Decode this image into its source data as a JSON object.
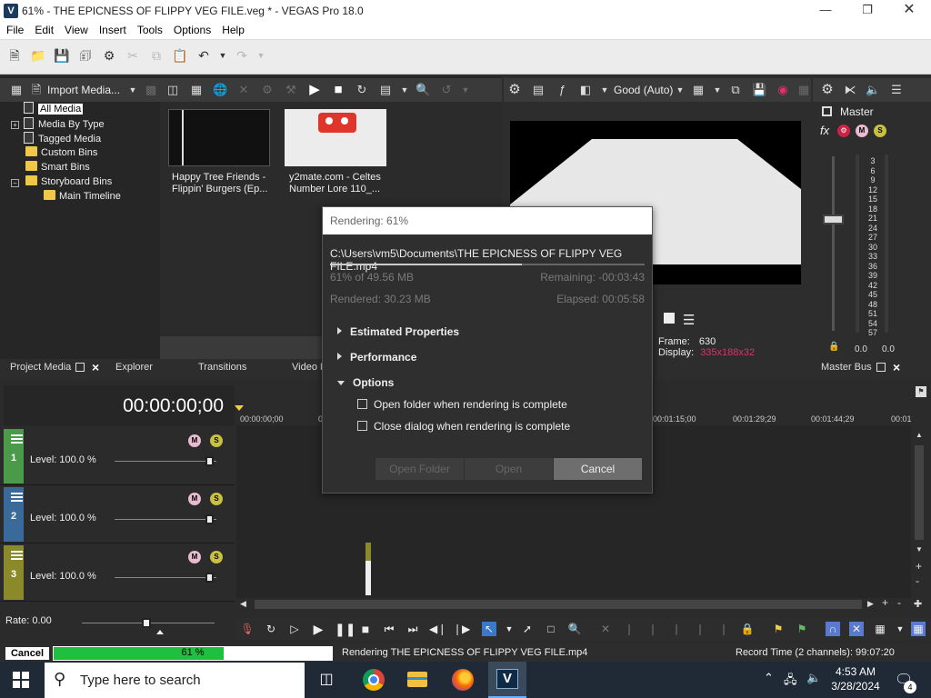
{
  "window": {
    "title": "61% - THE EPICNESS OF FLIPPY VEG FILE.veg * - VEGAS Pro 18.0",
    "app_icon": "V"
  },
  "menu": [
    "File",
    "Edit",
    "View",
    "Insert",
    "Tools",
    "Options",
    "Help"
  ],
  "media_panel": {
    "import_label": "Import Media...",
    "tree": [
      {
        "label": "All Media",
        "selected": true
      },
      {
        "label": "Media By Type"
      },
      {
        "label": "Tagged Media"
      },
      {
        "label": "Custom Bins"
      },
      {
        "label": "Smart Bins"
      },
      {
        "label": "Storyboard Bins"
      },
      {
        "label": "Main Timeline"
      }
    ],
    "thumbnails": [
      {
        "caption1": "Happy Tree Friends -",
        "caption2": "Flippin' Burgers (Ep..."
      },
      {
        "caption1": "y2mate.com - Celtes",
        "caption2": "Number Lore 110_..."
      }
    ],
    "tabs": [
      "Project Media",
      "Explorer",
      "Transitions",
      "Video F"
    ]
  },
  "preview": {
    "quality": "Good (Auto)",
    "frame_label": "Frame:",
    "frame_value": "630",
    "display_label": "Display:",
    "display_value": "335x188x32"
  },
  "master": {
    "label": "Master",
    "fx": "fx",
    "scale": [
      "3",
      "6",
      "9",
      "12",
      "15",
      "18",
      "21",
      "24",
      "27",
      "30",
      "33",
      "36",
      "39",
      "42",
      "45",
      "48",
      "51",
      "54",
      "57"
    ],
    "left_val": "0.0",
    "right_val": "0.0",
    "tab": "Master Bus"
  },
  "timeline": {
    "timecode": "00:00:00;00",
    "ruler": [
      "00:00:00;00",
      "0",
      "00:01:15;00",
      "00:01:29;29",
      "00:01:44;29",
      "00:01"
    ],
    "tracks": [
      {
        "num": "1",
        "level": "Level: 100.0 %",
        "color": "#4a9a4a"
      },
      {
        "num": "2",
        "level": "Level: 100.0 %",
        "color": "#3a6a9a"
      },
      {
        "num": "3",
        "level": "Level: 100.0 %",
        "color": "#8a8a2a"
      }
    ],
    "rate": "Rate: 0.00"
  },
  "render_dialog": {
    "title": "Rendering: 61%",
    "path": "C:\\Users\\vm5\\Documents\\THE EPICNESS OF FLIPPY VEG FILE.mp4",
    "progress_fraction": 0.61,
    "size_progress": "61% of 49.56 MB",
    "remaining": "Remaining: -00:03:43",
    "rendered": "Rendered: 30.23 MB",
    "elapsed": "Elapsed: 00:05:58",
    "sections": [
      "Estimated Properties",
      "Performance",
      "Options"
    ],
    "options": [
      "Open folder when rendering is complete",
      "Close dialog when rendering is complete"
    ],
    "buttons": {
      "open_folder": "Open Folder",
      "open": "Open",
      "cancel": "Cancel"
    }
  },
  "status": {
    "cancel": "Cancel",
    "percent": "61 %",
    "progress_fraction": 0.61,
    "message": "Rendering THE EPICNESS OF FLIPPY VEG FILE.mp4",
    "record_time": "Record Time (2 channels): 99:07:20"
  },
  "taskbar": {
    "search_placeholder": "Type here to search",
    "time": "4:53 AM",
    "date": "3/28/2024",
    "notification_count": "4"
  }
}
